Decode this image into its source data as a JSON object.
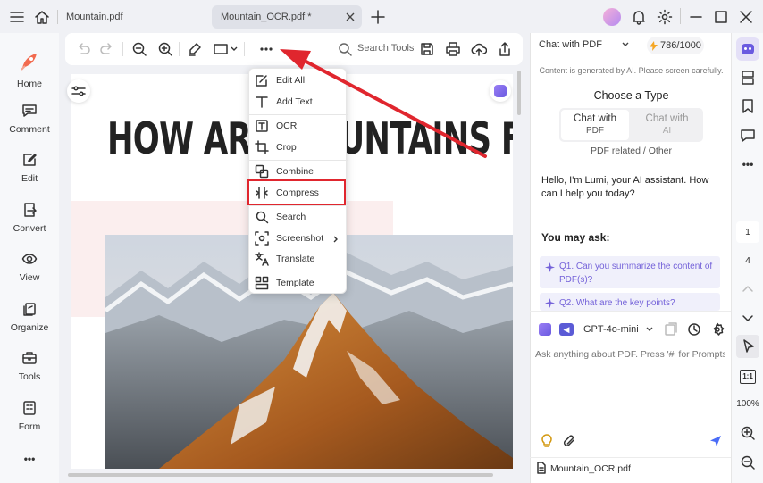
{
  "titlebar": {
    "tabs": [
      {
        "label": "Mountain.pdf"
      },
      {
        "label": "Mountain_OCR.pdf *"
      }
    ]
  },
  "leftnav": {
    "items": [
      {
        "label": "Home",
        "icon": "home-icon"
      },
      {
        "label": "Comment",
        "icon": "comment-icon"
      },
      {
        "label": "Edit",
        "icon": "edit-icon"
      },
      {
        "label": "Convert",
        "icon": "convert-icon"
      },
      {
        "label": "View",
        "icon": "view-icon"
      },
      {
        "label": "Organize",
        "icon": "organize-icon"
      },
      {
        "label": "Tools",
        "icon": "tools-icon"
      },
      {
        "label": "Form",
        "icon": "form-icon"
      }
    ],
    "more": "•••"
  },
  "toolbar": {
    "search_label": "Search Tools"
  },
  "document": {
    "heading": "HOW ARE MOUNTAINS FORMED"
  },
  "menu": {
    "items": [
      {
        "label": "Edit All"
      },
      {
        "label": "Add Text"
      },
      {
        "label": "OCR"
      },
      {
        "label": "Crop"
      },
      {
        "label": "Combine"
      },
      {
        "label": "Compress"
      },
      {
        "label": "Search"
      },
      {
        "label": "Screenshot"
      },
      {
        "label": "Translate"
      },
      {
        "label": "Template"
      }
    ],
    "highlighted": "Compress"
  },
  "chat": {
    "mode": "Chat with PDF",
    "credits": "786/1000",
    "notice": "Content is generated by AI. Please screen carefully.",
    "choose_title": "Choose a Type",
    "type_options": [
      {
        "title": "Chat with",
        "sub": "PDF"
      },
      {
        "title": "Chat with",
        "sub": "AI"
      }
    ],
    "type_caption": "PDF related / Other",
    "greeting": "Hello, I'm Lumi, your AI assistant. How can I help you today?",
    "may_ask": "You may ask:",
    "questions": [
      "Q1. Can you summarize the content of PDF(s)?",
      "Q2. What are the key points?"
    ],
    "model": "GPT-4o-mini",
    "input_placeholder": "Ask anything about PDF. Press '#' for Prompts.",
    "file": "Mountain_OCR.pdf"
  },
  "rightbar": {
    "page_current": "1",
    "page_total": "4",
    "fit_label": "1:1",
    "zoom": "100%"
  },
  "colors": {
    "accent": "#7462d9",
    "highlight_border": "#e0262e",
    "arrow": "#e0262e",
    "credit_icon": "#f5a623"
  }
}
